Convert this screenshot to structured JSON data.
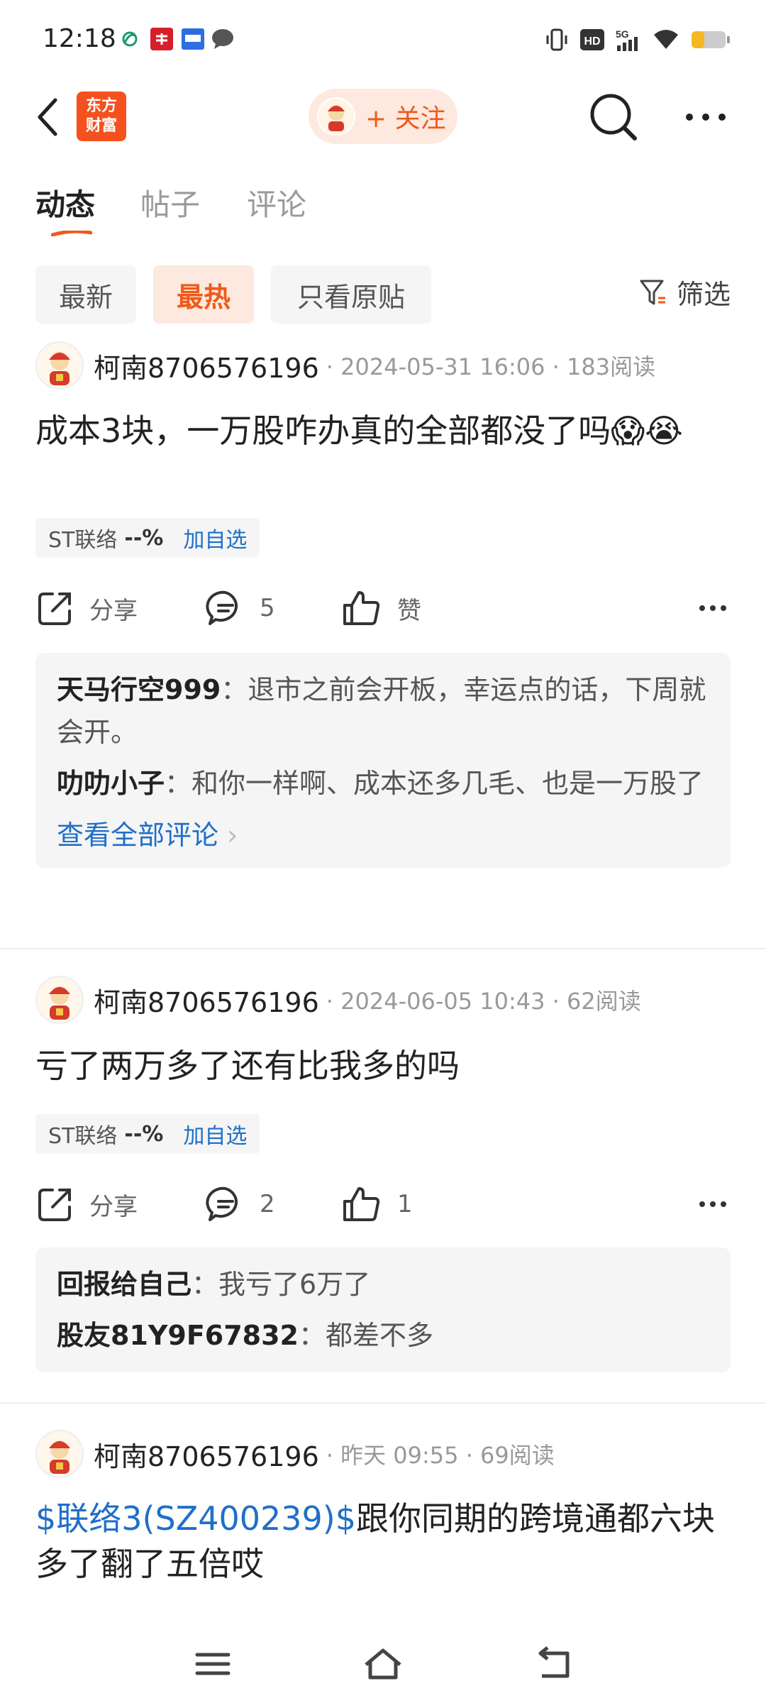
{
  "status_bar": {
    "time": "12:18",
    "network": "5G",
    "indicators": [
      "vibrate-icon",
      "hd-icon",
      "5g-icon",
      "wifi-icon",
      "battery-icon"
    ]
  },
  "nav": {
    "logo_line1": "东方",
    "logo_line2": "财富",
    "follow_label": "+ 关注"
  },
  "tabs": [
    "动态",
    "帖子",
    "评论"
  ],
  "filters": {
    "chips": [
      "最新",
      "最热",
      "只看原贴"
    ],
    "active": "最热",
    "filter_label": "筛选"
  },
  "posts": [
    {
      "username": "柯南8706576196",
      "meta": "· 2024-05-31 16:06 · 183阅读",
      "text": "成本3块，一万股咋办真的全部都没了吗😱😭",
      "stock": {
        "name": "ST联络",
        "change": "--%",
        "add_label": "加自选"
      },
      "share_label": "分享",
      "comment_count": "5",
      "like_label": "赞",
      "comments": [
        {
          "author": "天马行空999",
          "text": "退市之前会开板，幸运点的话，下周就会开。"
        },
        {
          "author": "叻叻小子",
          "text": "和你一样啊、成本还多几毛、也是一万股了"
        }
      ],
      "view_all": "查看全部评论"
    },
    {
      "username": "柯南8706576196",
      "meta": "· 2024-06-05 10:43 · 62阅读",
      "text": "亏了两万多了还有比我多的吗",
      "stock": {
        "name": "ST联络",
        "change": "--%",
        "add_label": "加自选"
      },
      "share_label": "分享",
      "comment_count": "2",
      "like_label": "1",
      "comments": [
        {
          "author": "回报给自己",
          "text": "我亏了6万了"
        },
        {
          "author": "股友81Y9F67832",
          "text": "都差不多"
        }
      ]
    },
    {
      "username": "柯南8706576196",
      "meta": "· 昨天 09:55 · 69阅读",
      "text_link": "$联络3(SZ400239)$",
      "text": "跟你同期的跨境通都六块多了翻了五倍哎"
    }
  ],
  "colors": {
    "accent": "#ef5a1a",
    "link": "#1f6fc8",
    "chip_bg": "#f5f5f5",
    "follow_bg": "#fde9df"
  }
}
